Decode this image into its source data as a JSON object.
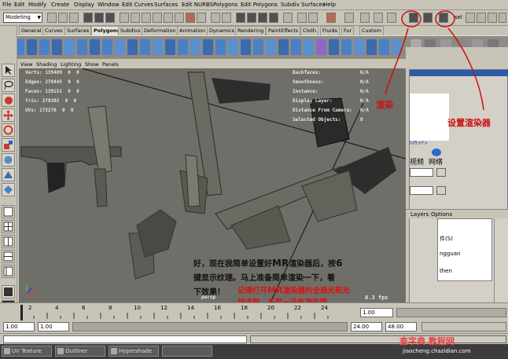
{
  "menubar": {
    "items": [
      "File",
      "Edit",
      "Modify",
      "Create",
      "Display",
      "Window",
      "Edit Curves",
      "Surfaces",
      "Edit NURBS",
      "Polygons",
      "Edit Polygons",
      "Subdiv Surfaces",
      "Help"
    ]
  },
  "statusline": {
    "mode": "Modeling",
    "sel_label": "sel"
  },
  "shelf_tabs": [
    "General",
    "Curves",
    "Surfaces",
    "Polygons",
    "Subdivs",
    "Deformation",
    "Animation",
    "Dynamics",
    "Rendering",
    "PaintEffects",
    "Cloth",
    "Fluids",
    "Fur",
    "Custom"
  ],
  "shelf_active_tab": "Polygons",
  "panel_menu": [
    "View",
    "Shading",
    "Lighting",
    "Show",
    "Panels"
  ],
  "hud": {
    "left": [
      {
        "label": "Verts:",
        "v1": "139409",
        "v2": "0",
        "v3": "0"
      },
      {
        "label": "Edges:",
        "v1": "278445",
        "v2": "0",
        "v3": "0"
      },
      {
        "label": "Faces:",
        "v1": "139151",
        "v2": "0",
        "v3": "0"
      },
      {
        "label": "Tris:",
        "v1": "278302",
        "v2": "0",
        "v3": "0"
      },
      {
        "label": "UVs:",
        "v1": "173276",
        "v2": "0",
        "v3": "0"
      }
    ],
    "right": [
      {
        "label": "Backfaces:",
        "value": "N/A"
      },
      {
        "label": "Smoothness:",
        "value": "N/A"
      },
      {
        "label": "Instance:",
        "value": "N/A"
      },
      {
        "label": "Display Layer:",
        "value": "N/A"
      },
      {
        "label": "Distance From Camera:",
        "value": "N/A"
      },
      {
        "label": "Selected Objects:",
        "value": "0"
      }
    ],
    "camera": "persp",
    "fps": "0.3 fps"
  },
  "annotations": {
    "render": "渲染",
    "render_settings": "设置渲染器"
  },
  "caption": {
    "line1_a": "好，现在我简单设置好",
    "line1_b": "MR",
    "line1_c": "渲染器后，按",
    "line1_d": "6",
    "line2": "键显示纹理。马上准备简单渲染一下，看",
    "line3": "下效果！",
    "red1_a": "记得打开",
    "red1_b": "MR",
    "red1_c": "渲染器的全局光和光",
    "red2": "线追踪，不然一没有渲染哦。"
  },
  "right_panel": {
    "shortcut_fragment": "hift+F>",
    "video": "视频",
    "network": "网络",
    "layers": "Layers",
    "options": "Options",
    "file_fragment": "件(S)",
    "user_fragment1": "ngguan",
    "user_fragment2": "then"
  },
  "time_slider": {
    "ticks": [
      "2",
      "4",
      "6",
      "8",
      "10",
      "12",
      "14",
      "16",
      "18",
      "20",
      "22",
      "24"
    ],
    "current": "1.00"
  },
  "range": {
    "start": "1.00",
    "start2": "1.00",
    "end": "24.00",
    "end2": "48.00"
  },
  "taskbar": [
    "UV Texture",
    "Outliner",
    "Hypershade"
  ],
  "watermark": {
    "line1": "查字典 教程网",
    "line2": "jiaocheng.chazidian.com"
  }
}
